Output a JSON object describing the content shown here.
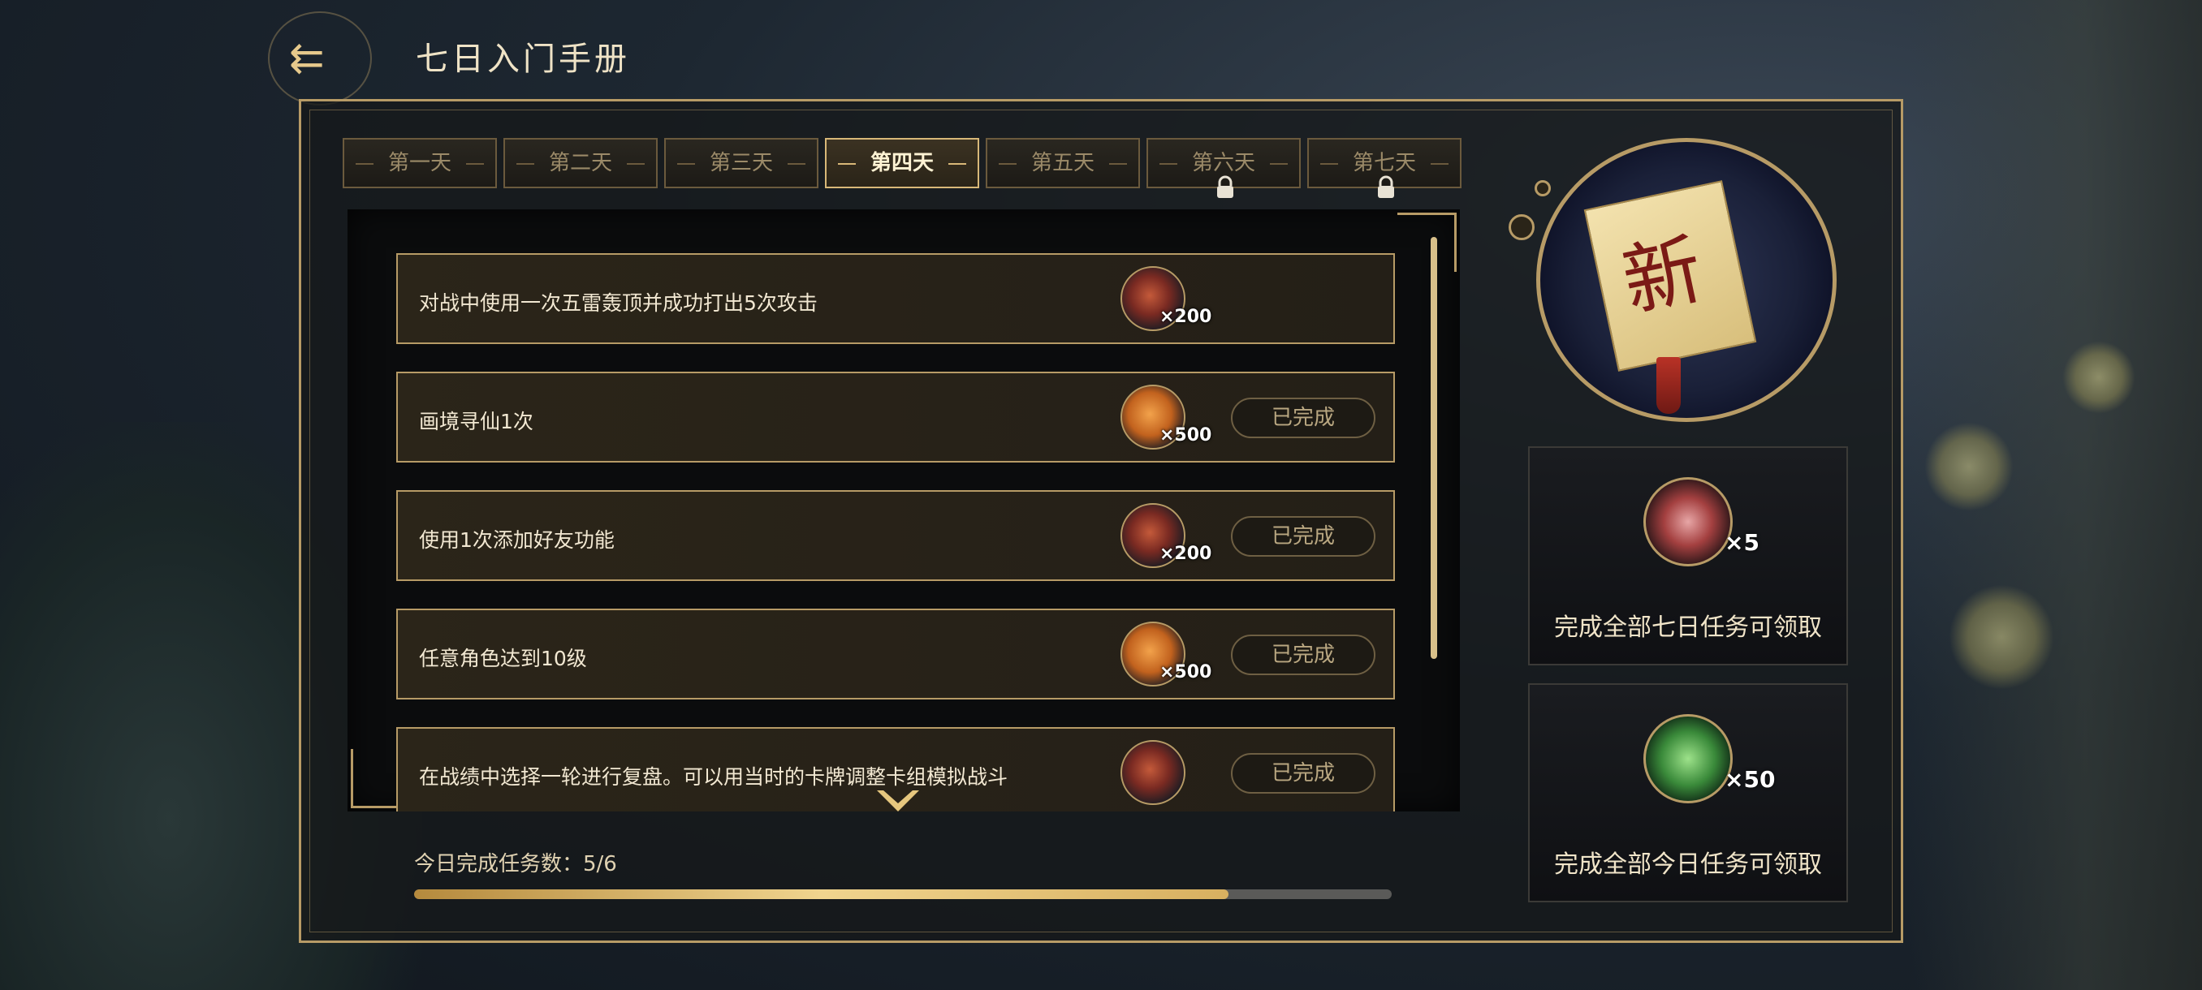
{
  "header": {
    "title": "七日入门手册",
    "back_icon": "back-arrow-icon"
  },
  "day_tabs": [
    {
      "label": "第一天",
      "state": "normal"
    },
    {
      "label": "第二天",
      "state": "normal"
    },
    {
      "label": "第三天",
      "state": "normal"
    },
    {
      "label": "第四天",
      "state": "active"
    },
    {
      "label": "第五天",
      "state": "normal"
    },
    {
      "label": "第六天",
      "state": "locked"
    },
    {
      "label": "第七天",
      "state": "locked"
    }
  ],
  "tasks": [
    {
      "text": "对战中使用一次五雷轰顶并成功打出5次攻击",
      "reward_icon": "card-pack-icon",
      "reward_amount": "×200",
      "status": ""
    },
    {
      "text": "画境寻仙1次",
      "reward_icon": "orange-token-icon",
      "reward_amount": "×500",
      "status": "已完成"
    },
    {
      "text": "使用1次添加好友功能",
      "reward_icon": "card-pack-icon",
      "reward_amount": "×200",
      "status": "已完成"
    },
    {
      "text": "任意角色达到10级",
      "reward_icon": "orange-token-icon",
      "reward_amount": "×500",
      "status": "已完成"
    },
    {
      "text": "在战绩中选择一轮进行复盘。可以用当时的卡牌调整卡组模拟战斗",
      "reward_icon": "card-pack-icon",
      "reward_amount": "",
      "status": "已完成"
    }
  ],
  "progress": {
    "label": "今日完成任务数：5/6",
    "completed": 5,
    "total": 6
  },
  "emblem": {
    "character": "新"
  },
  "rewards": {
    "seven_day": {
      "icon": "red-chest-icon",
      "quantity": "×5",
      "caption": "完成全部七日任务可领取"
    },
    "today": {
      "icon": "green-jade-icon",
      "quantity": "×50",
      "caption": "完成全部今日任务可领取"
    }
  },
  "colors": {
    "gold": "#b79b66",
    "active_text": "#fff3d4",
    "panel_bg": "#0b0c0d"
  }
}
